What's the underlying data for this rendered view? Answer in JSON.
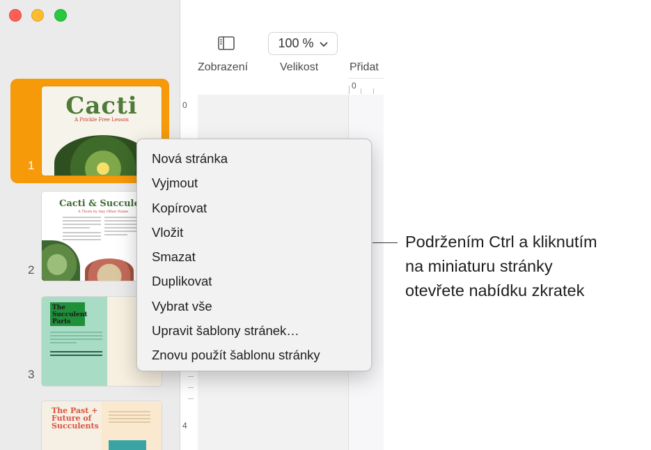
{
  "toolbar": {
    "zoom_value": "100 %",
    "labels": [
      "Zobrazení",
      "Velikost",
      "Přidat"
    ]
  },
  "thumbnails": [
    {
      "page_number": "1",
      "title": "Cacti",
      "subtitle": "A Prickle Free Lesson",
      "selected": true
    },
    {
      "page_number": "2",
      "title": "Cacti & Succulents",
      "subtitle": "A Thorn by Any Other Name"
    },
    {
      "page_number": "3",
      "title": "The Succulent Parts"
    },
    {
      "page_number": "",
      "title": "The Past + Future of Succulents"
    }
  ],
  "rulers": {
    "h_zero": "0",
    "v_zero": "0",
    "v_four": "4"
  },
  "context_menu": {
    "items": [
      "Nová stránka",
      "Vyjmout",
      "Kopírovat",
      "Vložit",
      "Smazat",
      "Duplikovat",
      "Vybrat vše",
      "Upravit šablony stránek…",
      "Znovu použít šablonu stránky"
    ]
  },
  "callout": {
    "lines": [
      "Podržením Ctrl a kliknutím",
      "na miniaturu stránky",
      "otevřete nabídku zkratek"
    ]
  },
  "colors": {
    "selection": "#f79a0a",
    "close": "#ff5f57",
    "minimize": "#febc2e",
    "zoom": "#28c840"
  }
}
